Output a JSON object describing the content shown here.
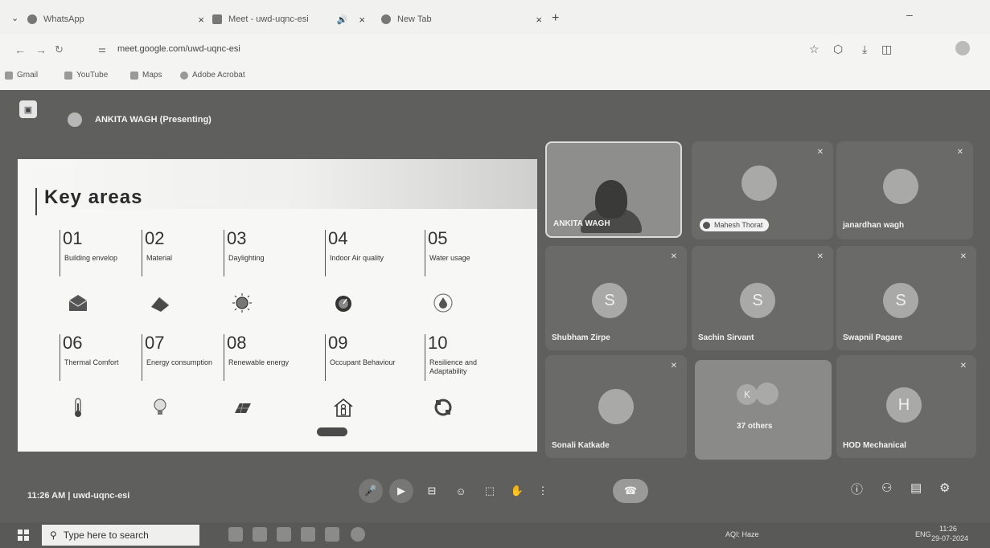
{
  "browser": {
    "tabs": [
      {
        "title": "WhatsApp",
        "close": "×"
      },
      {
        "title": "Meet - uwd-uqnc-esi",
        "close": "×",
        "audio": "🔊"
      },
      {
        "title": "New Tab",
        "close": "×"
      }
    ],
    "new_tab": "+",
    "url": "meet.google.com/uwd-uqnc-esi",
    "bookmarks": [
      "Gmail",
      "YouTube",
      "Maps",
      "Adobe Acrobat"
    ]
  },
  "meet": {
    "presenter_label": "ANKITA WAGH (Presenting)",
    "meeting_info": "11:26 AM  |  uwd-uqnc-esi",
    "slide": {
      "title": "Key areas",
      "areas": [
        {
          "num": "01",
          "label": "Building envelop",
          "icon": "envelope-icon"
        },
        {
          "num": "02",
          "label": "Material",
          "icon": "bricks-icon"
        },
        {
          "num": "03",
          "label": "Daylighting",
          "icon": "sun-icon"
        },
        {
          "num": "04",
          "label": "Indoor Air quality",
          "icon": "gauge-icon"
        },
        {
          "num": "05",
          "label": "Water usage",
          "icon": "water-drop-icon"
        },
        {
          "num": "06",
          "label": "Thermal Comfort",
          "icon": "thermometer-icon"
        },
        {
          "num": "07",
          "label": "Energy consumption",
          "icon": "bulb-icon"
        },
        {
          "num": "08",
          "label": "Renewable energy",
          "icon": "solar-panel-icon"
        },
        {
          "num": "09",
          "label": "Occupant Behaviour",
          "icon": "house-person-icon"
        },
        {
          "num": "10",
          "label": "Resilience and Adaptability",
          "icon": "cycle-icon"
        }
      ]
    },
    "participants": [
      {
        "name": "ANKITA WAGH",
        "type": "video"
      },
      {
        "name": "Mahesh Thorat",
        "type": "photo-chip"
      },
      {
        "name": "janardhan wagh",
        "type": "photo"
      },
      {
        "name": "Shubham Zirpe",
        "initial": "S"
      },
      {
        "name": "Sachin Sirvant",
        "initial": "S"
      },
      {
        "name": "Swapnil Pagare",
        "initial": "S"
      },
      {
        "name": "Sonali Katkade",
        "type": "photo"
      },
      {
        "name": "37 others",
        "initial": "K"
      },
      {
        "name": "HOD Mechanical",
        "initial": "H"
      }
    ]
  },
  "taskbar": {
    "search_placeholder": "Type here to search",
    "tray": {
      "weather": "AQI: Haze",
      "lang": "ENG",
      "time": "11:26",
      "date": "29-07-2024"
    }
  }
}
